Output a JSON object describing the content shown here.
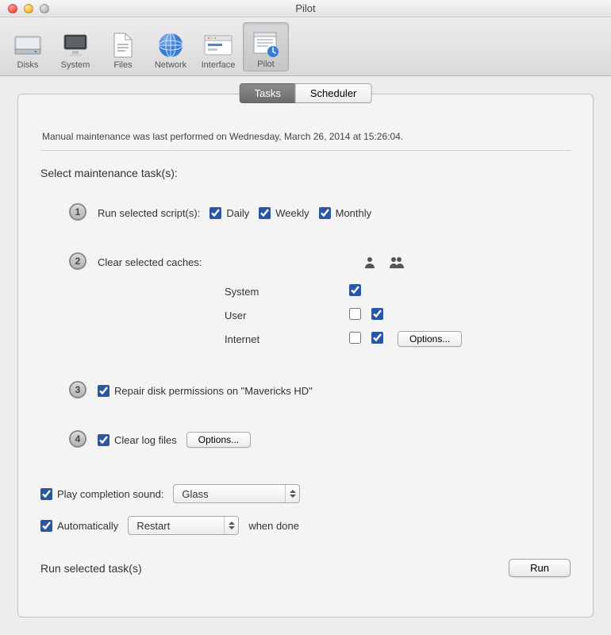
{
  "window": {
    "title": "Pilot"
  },
  "toolbar": {
    "items": [
      {
        "label": "Disks"
      },
      {
        "label": "System"
      },
      {
        "label": "Files"
      },
      {
        "label": "Network"
      },
      {
        "label": "Interface"
      },
      {
        "label": "Pilot"
      }
    ],
    "selected_index": 5
  },
  "tabs": {
    "tasks": "Tasks",
    "scheduler": "Scheduler",
    "active": "tasks"
  },
  "status": "Manual maintenance was last performed on Wednesday, March 26, 2014 at 15:26:04.",
  "section_header": "Select maintenance task(s):",
  "task1": {
    "label": "Run selected script(s):",
    "daily": {
      "label": "Daily",
      "checked": true
    },
    "weekly": {
      "label": "Weekly",
      "checked": true
    },
    "monthly": {
      "label": "Monthly",
      "checked": true
    }
  },
  "task2": {
    "label": "Clear selected caches:",
    "rows": {
      "system": {
        "label": "System",
        "single": true
      },
      "user": {
        "label": "User",
        "single": false,
        "multi": true
      },
      "internet": {
        "label": "Internet",
        "single": false,
        "multi": true
      }
    },
    "options_label": "Options..."
  },
  "task3": {
    "checked": true,
    "label": "Repair disk permissions on \"Mavericks HD\""
  },
  "task4": {
    "checked": true,
    "label": "Clear log files",
    "options_label": "Options..."
  },
  "play_sound": {
    "checked": true,
    "label": "Play completion sound:",
    "value": "Glass"
  },
  "auto": {
    "checked": true,
    "label_prefix": "Automatically",
    "value": "Restart",
    "label_suffix": "when done"
  },
  "footer": {
    "label": "Run selected task(s)",
    "run": "Run"
  }
}
